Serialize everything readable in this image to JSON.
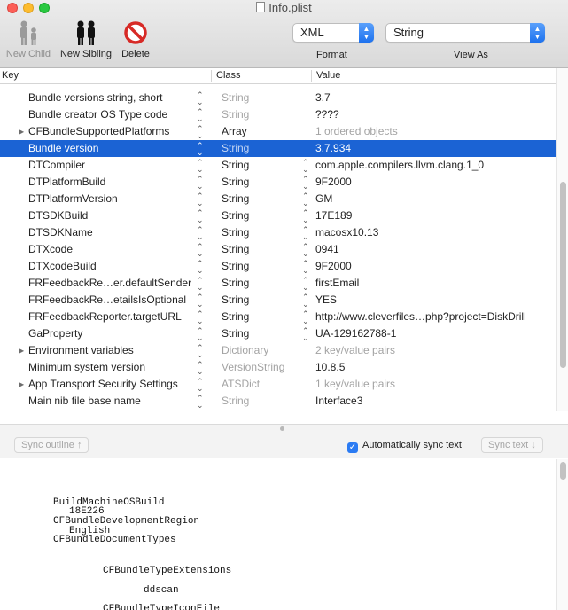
{
  "window": {
    "title": "Info.plist"
  },
  "toolbar": {
    "new_child_label": "New Child",
    "new_sibling_label": "New Sibling",
    "delete_label": "Delete",
    "format_value": "XML",
    "viewas_value": "String",
    "format_caption": "Format",
    "viewas_caption": "View As"
  },
  "columns": {
    "key": "Key",
    "class": "Class",
    "value": "Value"
  },
  "rows": [
    {
      "key": "Bundle versions string, short",
      "class": "String",
      "value": "3.7",
      "class_muted": true
    },
    {
      "key": "Bundle creator OS Type code",
      "class": "String",
      "value": "????",
      "class_muted": true
    },
    {
      "key": "CFBundleSupportedPlatforms",
      "class": "Array",
      "value": "1 ordered objects",
      "expandable": true,
      "value_muted": true
    },
    {
      "key": "Bundle version",
      "class": "String",
      "value": "3.7.934",
      "selected": true,
      "class_muted": true
    },
    {
      "key": "DTCompiler",
      "class": "String",
      "value": "com.apple.compilers.llvm.clang.1_0",
      "vstep": true
    },
    {
      "key": "DTPlatformBuild",
      "class": "String",
      "value": "9F2000",
      "vstep": true
    },
    {
      "key": "DTPlatformVersion",
      "class": "String",
      "value": "GM",
      "vstep": true
    },
    {
      "key": "DTSDKBuild",
      "class": "String",
      "value": "17E189",
      "vstep": true
    },
    {
      "key": "DTSDKName",
      "class": "String",
      "value": "macosx10.13",
      "vstep": true
    },
    {
      "key": "DTXcode",
      "class": "String",
      "value": "0941",
      "vstep": true
    },
    {
      "key": "DTXcodeBuild",
      "class": "String",
      "value": "9F2000",
      "vstep": true
    },
    {
      "key": "FRFeedbackRe…er.defaultSender",
      "class": "String",
      "value": "firstEmail",
      "vstep": true
    },
    {
      "key": "FRFeedbackRe…etailsIsOptional",
      "class": "String",
      "value": "YES",
      "vstep": true
    },
    {
      "key": "FRFeedbackReporter.targetURL",
      "class": "String",
      "value": "http://www.cleverfiles…php?project=DiskDrill",
      "vstep": true
    },
    {
      "key": "GaProperty",
      "class": "String",
      "value": "UA-129162788-1",
      "vstep": true
    },
    {
      "key": "Environment variables",
      "class": "Dictionary",
      "value": "2 key/value pairs",
      "expandable": true,
      "class_muted": true,
      "value_muted": true
    },
    {
      "key": "Minimum system version",
      "class": "VersionString",
      "value": "10.8.5",
      "class_muted": true
    },
    {
      "key": "App Transport Security Settings",
      "class": "ATSDict",
      "value": "1 key/value pairs",
      "expandable": true,
      "class_muted": true,
      "value_muted": true
    },
    {
      "key": "Main nib file base name",
      "class": "String",
      "value": "Interface3",
      "class_muted": true
    }
  ],
  "sync": {
    "sync_outline_label": "Sync outline ↑",
    "auto_sync_label": "Automatically sync text",
    "sync_text_label": "Sync text ↓"
  },
  "text_lines": [
    {
      "indent": 0,
      "text": "BuildMachineOSBuild"
    },
    {
      "indent": 1,
      "text": "18E226"
    },
    {
      "indent": 0,
      "text": "CFBundleDevelopmentRegion"
    },
    {
      "indent": 1,
      "text": "English"
    },
    {
      "indent": 0,
      "text": "CFBundleDocumentTypes"
    },
    {
      "indent": 2,
      "text": "CFBundleTypeExtensions"
    },
    {
      "indent": 3,
      "text": "ddscan"
    },
    {
      "indent": 2,
      "text": "CFBundleTypeIconFile"
    }
  ]
}
